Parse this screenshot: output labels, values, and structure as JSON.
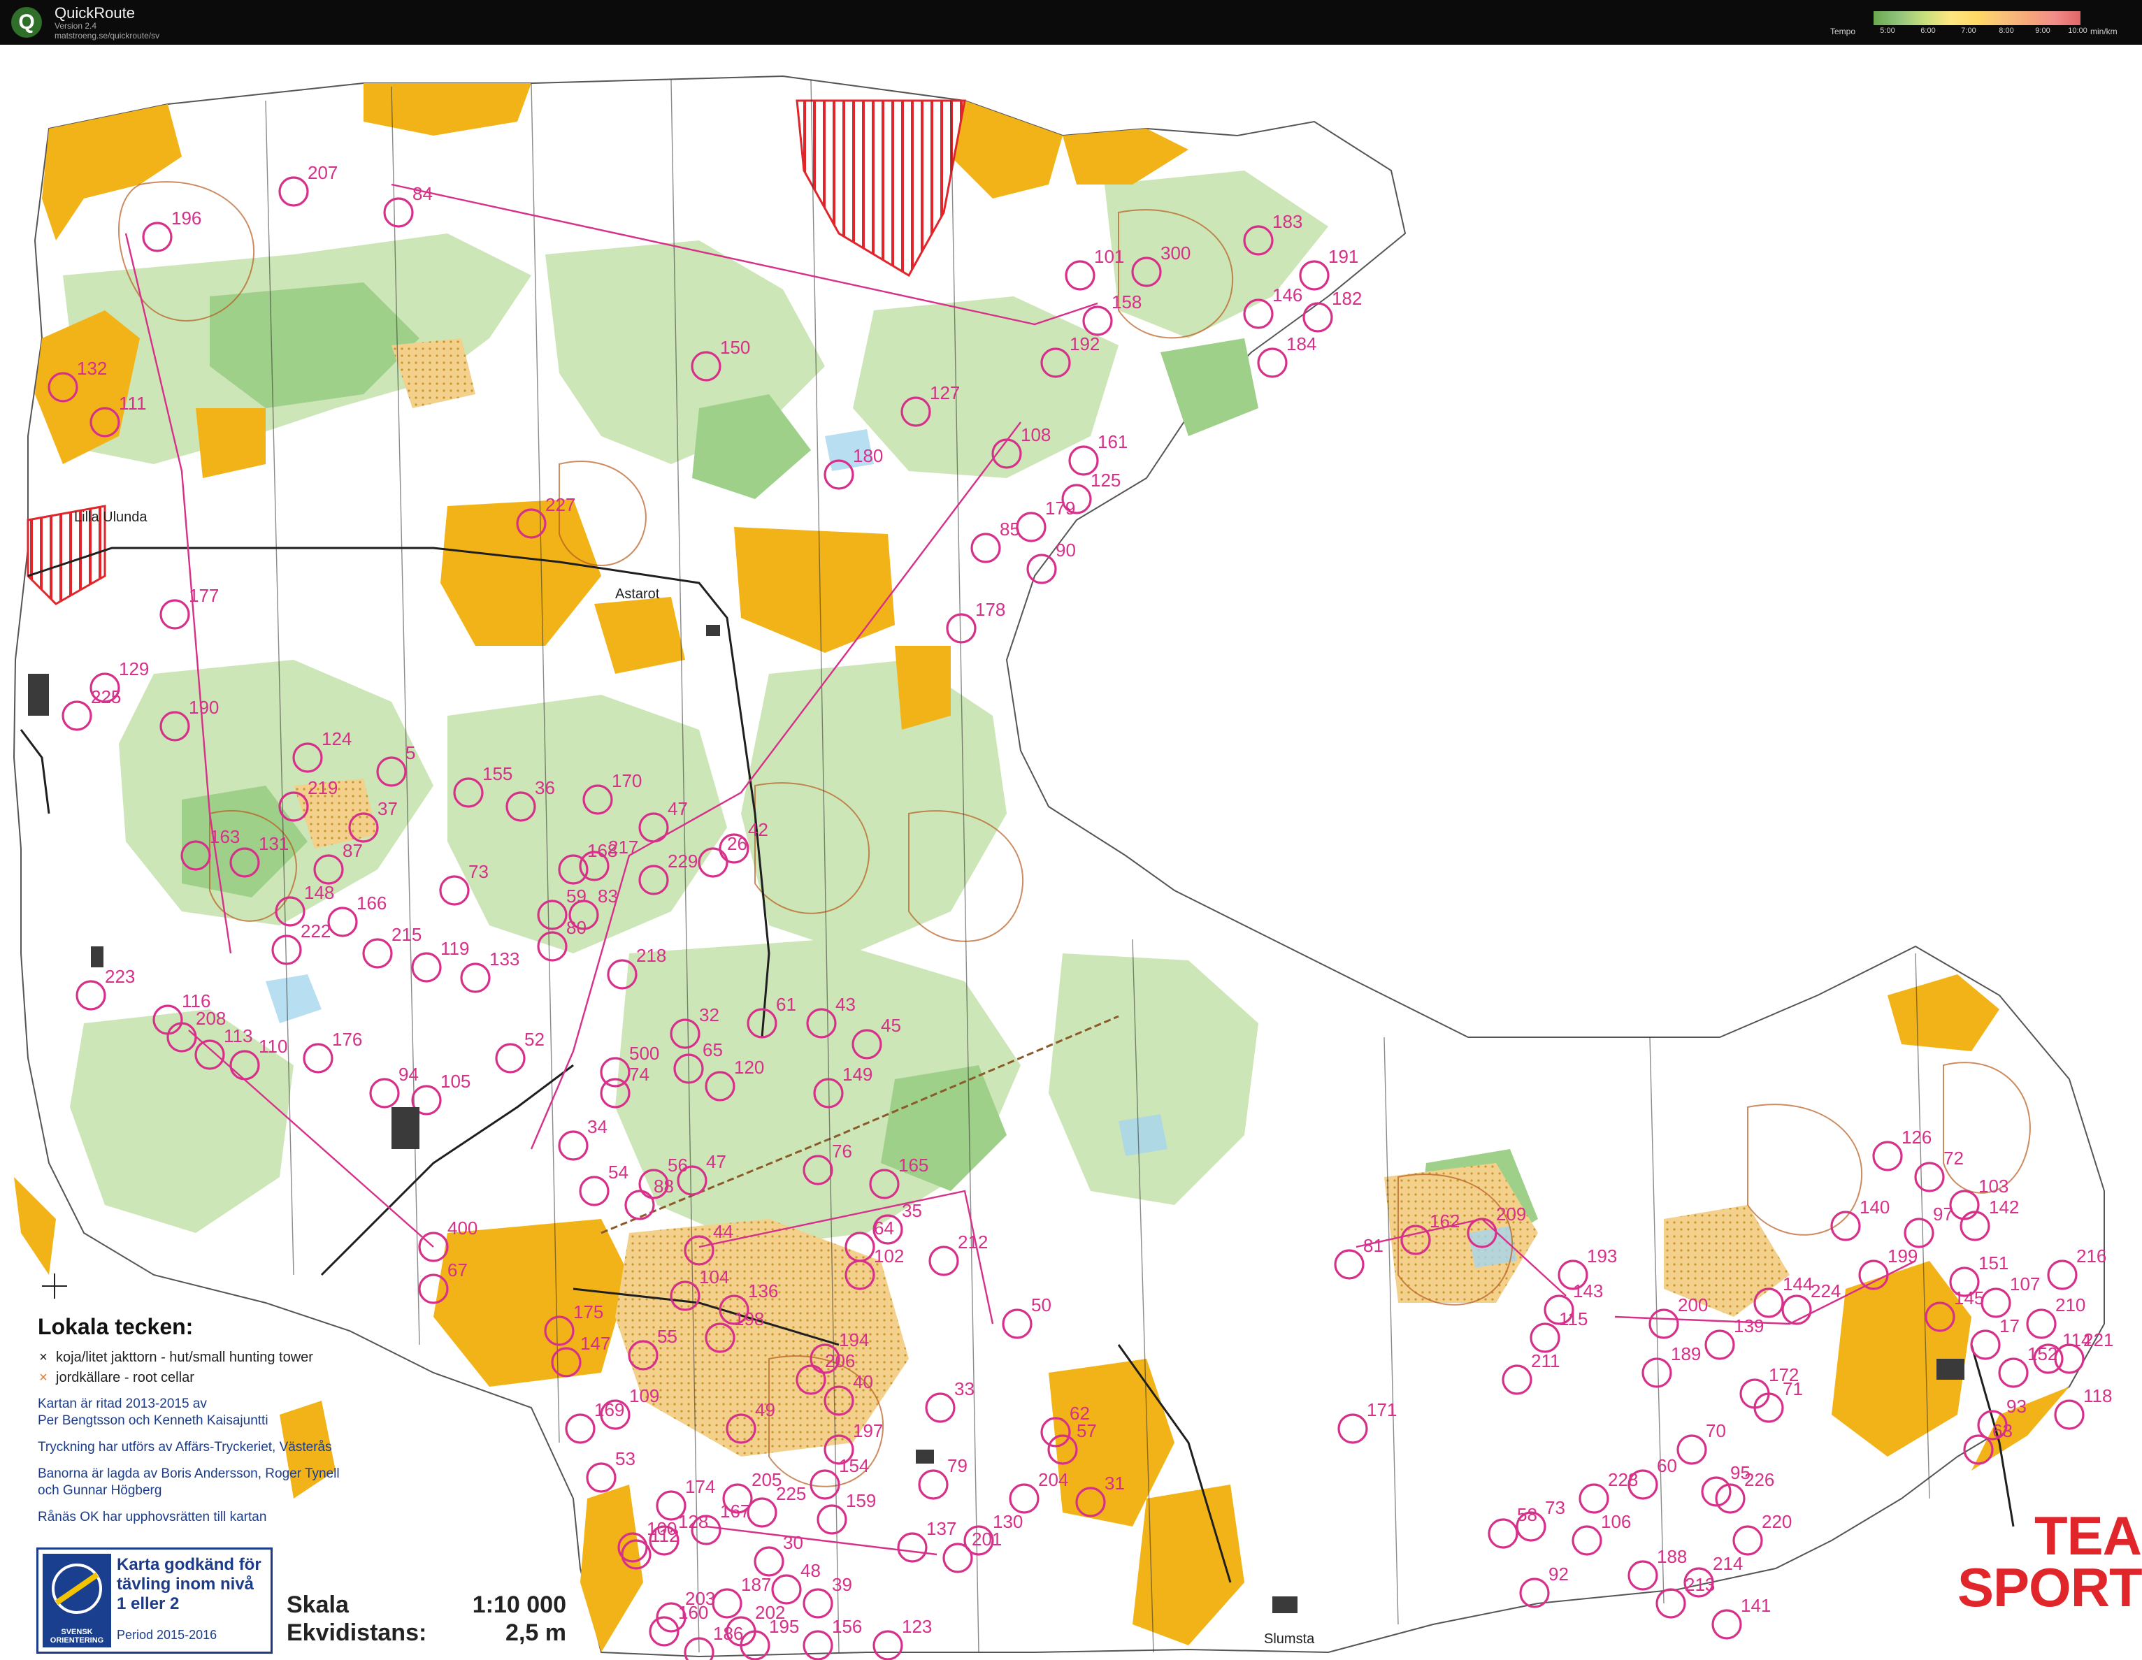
{
  "app": {
    "title": "QuickRoute",
    "version": "Version 2.4",
    "url": "matstroeng.se/quickroute/sv",
    "icon": "quickroute-logo-icon"
  },
  "tempo": {
    "label": "Tempo",
    "ticks": [
      "5:00",
      "6:00",
      "7:00",
      "8:00",
      "9:00",
      "10:00"
    ],
    "unit": "min/km",
    "colors": [
      "#6aa84f",
      "#c9e07d",
      "#ffe680",
      "#f6a77a",
      "#e06666"
    ]
  },
  "map": {
    "colors": {
      "open_land": "#f2b318",
      "light_green": "#cde6b7",
      "mid_green": "#9fd08a",
      "white_forest": "#ffffff",
      "contour": "#b65a1d",
      "course": "#d6308a",
      "water": "#a6d6ef",
      "forbidden": "#e0262b"
    },
    "places": [
      "Lilla Ulunda",
      "Astarot",
      "Slumsta"
    ],
    "controls": [
      "207",
      "84",
      "196",
      "183",
      "300",
      "101",
      "191",
      "182",
      "146",
      "158",
      "192",
      "184",
      "150",
      "127",
      "108",
      "161",
      "125",
      "132",
      "111",
      "180",
      "179",
      "227",
      "85",
      "90",
      "177",
      "129",
      "225",
      "190",
      "178",
      "124",
      "219",
      "5",
      "155",
      "36",
      "37",
      "170",
      "47",
      "42",
      "26",
      "163",
      "131",
      "87",
      "168",
      "217",
      "229",
      "148",
      "166",
      "73",
      "59",
      "83",
      "222",
      "215",
      "223",
      "80",
      "119",
      "133",
      "116",
      "208",
      "113",
      "218",
      "32",
      "61",
      "43",
      "45",
      "110",
      "176",
      "94",
      "105",
      "52",
      "500",
      "65",
      "120",
      "149",
      "74",
      "34",
      "54",
      "56",
      "47",
      "76",
      "165",
      "35",
      "64",
      "88",
      "44",
      "102",
      "212",
      "104",
      "136",
      "55",
      "194",
      "198",
      "147",
      "206",
      "400",
      "175",
      "50",
      "67",
      "49",
      "169",
      "109",
      "40",
      "33",
      "62",
      "57",
      "197",
      "53",
      "174",
      "154",
      "79",
      "205",
      "225",
      "204",
      "31",
      "159",
      "128",
      "112",
      "167",
      "100",
      "137",
      "30",
      "130",
      "48",
      "39",
      "201",
      "187",
      "203",
      "202",
      "160",
      "195",
      "186",
      "156",
      "123",
      "126",
      "72",
      "103",
      "97",
      "142",
      "140",
      "199",
      "151",
      "216",
      "107",
      "210",
      "145",
      "114",
      "17",
      "152",
      "221",
      "118",
      "171",
      "93",
      "63",
      "144",
      "224",
      "193",
      "209",
      "162",
      "81",
      "143",
      "115",
      "211",
      "200",
      "139",
      "189",
      "172",
      "70",
      "71",
      "60",
      "226",
      "95",
      "73",
      "228",
      "58",
      "106",
      "92",
      "188",
      "220",
      "214",
      "213",
      "141"
    ],
    "selected": "500"
  },
  "legend": {
    "title": "Lokala tecken:",
    "items": [
      {
        "symbol": "×",
        "text": "koja/litet jakttorn - hut/small hunting tower",
        "color": "#222222"
      },
      {
        "symbol": "×",
        "text": "jordkällare   -   root cellar",
        "color": "#e0782a"
      }
    ],
    "credits": [
      "Kartan är ritad 2013-2015 av",
      "Per Bengtsson och Kenneth Kaisajuntti",
      "Tryckning har utförs av Affärs-Tryckeriet, Västerås",
      "Banorna är lagda av Boris Andersson, Roger Tynell",
      "och Gunnar Högberg",
      "Rånäs OK har upphovsrätten till kartan"
    ]
  },
  "approval": {
    "org": "SVENSK ORIENTERING",
    "text": "Karta godkänd för tävling inom nivå 1 eller 2",
    "period": "Period 2015-2016"
  },
  "scale": {
    "label": "Skala",
    "value": "1:10 000",
    "equidistance_label": "Ekvidistans:",
    "equidistance_value": "2,5 m"
  },
  "sponsor": {
    "line1": "TEA",
    "line2": "SPORTIA"
  }
}
